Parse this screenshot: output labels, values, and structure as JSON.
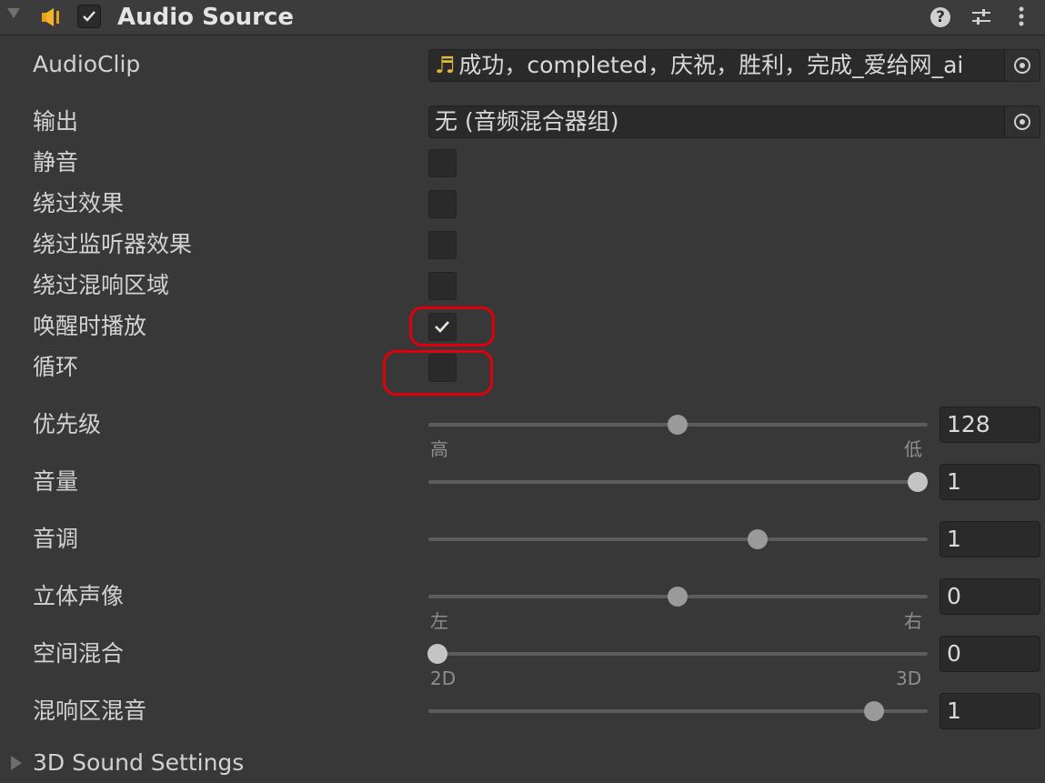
{
  "header": {
    "title": "Audio Source",
    "enabled": true
  },
  "fields": {
    "audioclip": {
      "label": "AudioClip",
      "icon": "♬",
      "value": "成功，completed，庆祝，胜利，完成_爱给网_ai"
    },
    "output": {
      "label": "输出",
      "value": "无 (音频混合器组)"
    },
    "mute": {
      "label": "静音",
      "checked": false
    },
    "bypass_effects": {
      "label": "绕过效果",
      "checked": false
    },
    "bypass_listener_effects": {
      "label": "绕过监听器效果",
      "checked": false
    },
    "bypass_reverb_zones": {
      "label": "绕过混响区域",
      "checked": false
    },
    "play_on_awake": {
      "label": "唤醒时播放",
      "checked": true
    },
    "loop": {
      "label": "循环",
      "checked": false
    }
  },
  "sliders": {
    "priority": {
      "label": "优先级",
      "value": "128",
      "min": 0,
      "max": 256,
      "left_label": "高",
      "right_label": "低"
    },
    "volume": {
      "label": "音量",
      "value": "1",
      "min": 0,
      "max": 1
    },
    "pitch": {
      "label": "音调",
      "value": "1",
      "min": -3,
      "max": 3
    },
    "stereo_pan": {
      "label": "立体声像",
      "value": "0",
      "min": -1,
      "max": 1,
      "left_label": "左",
      "right_label": "右"
    },
    "spatial_blend": {
      "label": "空间混合",
      "value": "0",
      "min": 0,
      "max": 1,
      "left_label": "2D",
      "right_label": "3D"
    },
    "reverb_zone_mix": {
      "label": "混响区混音",
      "value": "1",
      "min": 0,
      "max": 1.1
    }
  },
  "footer": {
    "label": "3D Sound Settings"
  },
  "colors": {
    "highlight": "#e0000b",
    "background": "#383838",
    "field": "#2a2a2a"
  }
}
